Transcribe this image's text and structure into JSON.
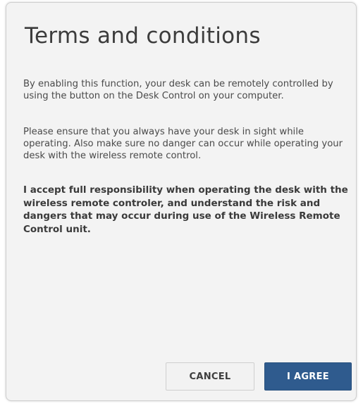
{
  "dialog": {
    "title": "Terms and conditions",
    "paragraph1": "By enabling this function, your desk can be remotely controlled by using the button on the Desk Control on your computer.",
    "paragraph2": "Please ensure that you always have your desk in sight while operating. Also make sure no danger can occur while operating your desk with the wireless remote control.",
    "paragraph3": "I accept full responsibility when operating the desk with the wireless remote controler, and understand the risk and dangers that may occur during use of the Wireless Remote Control unit.",
    "cancel_label": "CANCEL",
    "agree_label": "I AGREE"
  },
  "colors": {
    "dialog_background": "#f3f3f3",
    "agree_button": "#2f5b8e",
    "cancel_button": "#f2f2f2"
  }
}
